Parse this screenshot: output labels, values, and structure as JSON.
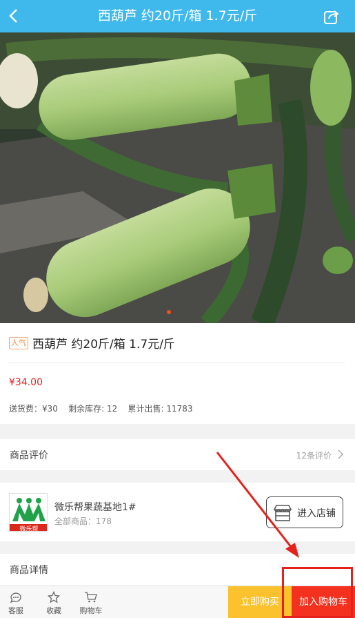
{
  "header": {
    "title": "西葫芦 约20斤/箱 1.7元/斤"
  },
  "product": {
    "hot_tag": "人气",
    "title": "西葫芦 约20斤/箱 1.7元/斤",
    "price": "¥34.00",
    "stats": "送货费：¥30    剩余库存: 12    累计出售: 11783"
  },
  "review": {
    "label": "商品评价",
    "count": "12条评价"
  },
  "shop": {
    "logo_text": "微乐帮",
    "name": "微乐帮果蔬基地1#",
    "count": "全部商品：178",
    "enter_label": "进入店铺"
  },
  "details": {
    "label": "商品详情"
  },
  "bottom": {
    "service": "客服",
    "favorite": "收藏",
    "cart": "购物车",
    "buy_now": "立即购买",
    "add_cart": "加入购物车"
  },
  "colors": {
    "topbar": "#3fb8ec",
    "price": "#e62020",
    "buy_now": "#fbc22e",
    "add_cart": "#f4311f",
    "annotation": "#e4211c"
  }
}
